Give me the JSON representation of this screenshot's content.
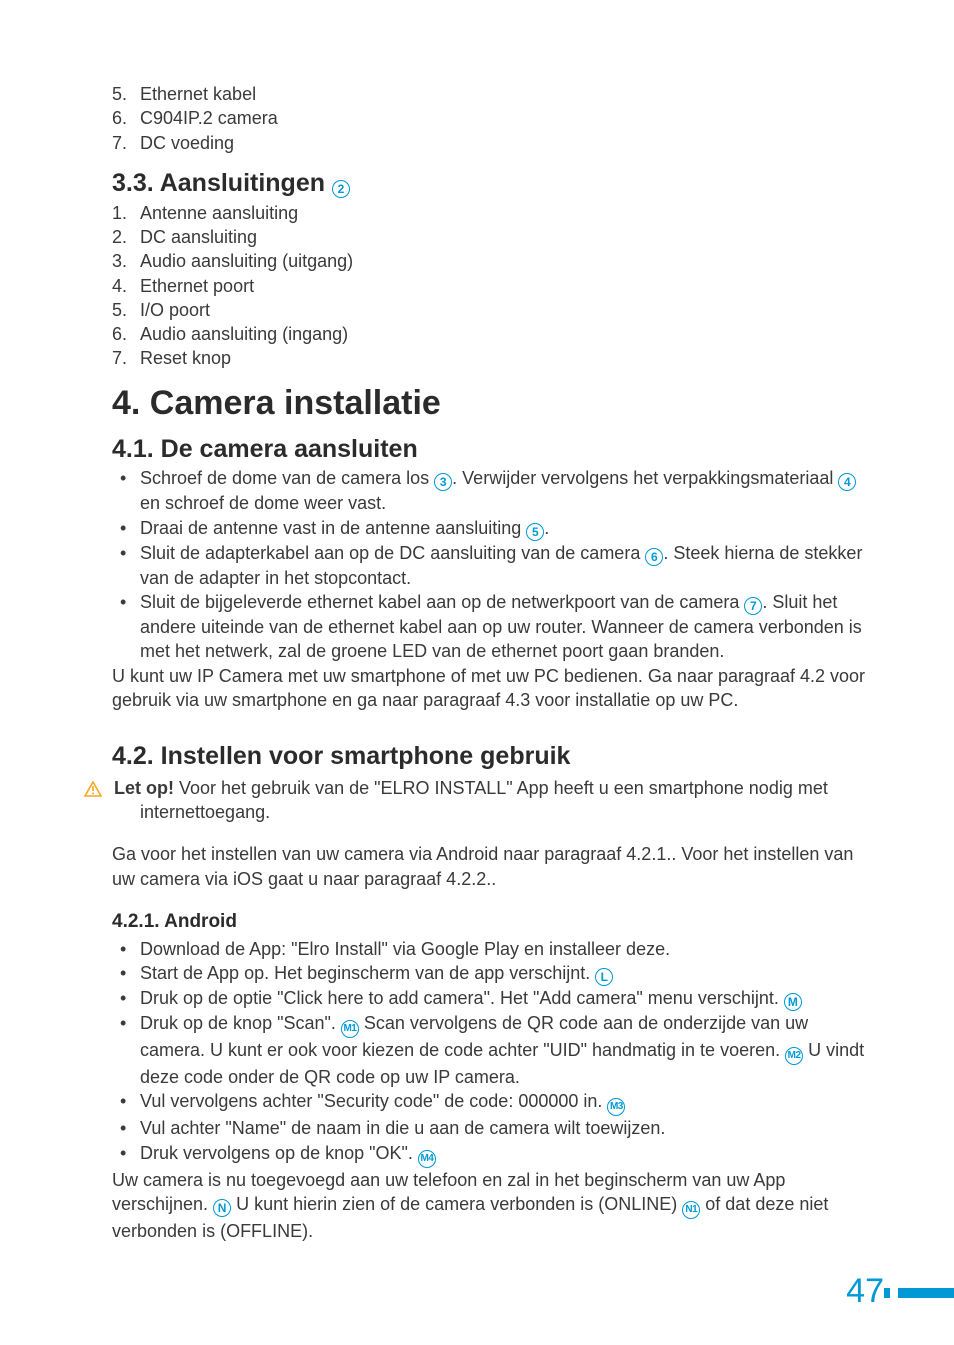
{
  "top_list": {
    "items": [
      {
        "n": "5.",
        "t": "Ethernet kabel"
      },
      {
        "n": "6.",
        "t": "C904IP.2 camera"
      },
      {
        "n": "7.",
        "t": "DC voeding"
      }
    ]
  },
  "s33": {
    "heading": "3.3.  Aansluitingen",
    "ref": "2",
    "items": [
      {
        "n": "1.",
        "t": "Antenne aansluiting"
      },
      {
        "n": "2.",
        "t": "DC aansluiting"
      },
      {
        "n": "3.",
        "t": "Audio aansluiting (uitgang)"
      },
      {
        "n": "4.",
        "t": "Ethernet poort"
      },
      {
        "n": "5.",
        "t": "I/O poort"
      },
      {
        "n": "6.",
        "t": "Audio aansluiting (ingang)"
      },
      {
        "n": "7.",
        "t": "Reset knop"
      }
    ]
  },
  "s4": {
    "heading": "4.    Camera installatie"
  },
  "s41": {
    "heading": "4.1.  De camera aansluiten",
    "b1a": "Schroef de dome van de camera los ",
    "r1": "3",
    "b1b": ". Verwijder vervolgens het verpakkingsmateriaal ",
    "r2": "4",
    "b1c": " en schroef de dome weer vast.",
    "b2a": "Draai de antenne vast in de antenne aansluiting ",
    "r3": "5",
    "b2b": ".",
    "b3a": "Sluit de adapterkabel aan op de DC aansluiting van de camera  ",
    "r4": "6",
    "b3b": ". Steek hierna de stekker van de adapter in het stopcontact.",
    "b4a": "Sluit de bijgeleverde ethernet kabel aan op de netwerkpoort van de camera ",
    "r5": "7",
    "b4b": ". Sluit het andere uiteinde van de ethernet kabel aan op uw router. Wanneer de camera verbonden is met het netwerk, zal de groene LED van de ethernet poort gaan branden.",
    "tail": "U kunt uw IP Camera met uw smartphone of met uw PC bedienen. Ga naar paragraaf 4.2 voor gebruik via uw smartphone en ga naar paragraaf 4.3 voor installatie op uw PC."
  },
  "s42": {
    "heading": "4.2.  Instellen voor smartphone gebruik",
    "attn_label": "Let op!",
    "attn_text": " Voor het gebruik van de \"ELRO INSTALL\" App heeft u een smartphone nodig met internettoegang.",
    "para": "Ga voor het instellen van uw camera via Android naar paragraaf 4.2.1.. Voor het instellen van uw camera via iOS gaat u naar paragraaf 4.2.2.."
  },
  "s421": {
    "heading": "4.2.1.  Android",
    "b1": "Download de App: \"Elro Install\" via Google Play en installeer deze.",
    "b2a": "Start de App op. Het beginscherm van de app verschijnt. ",
    "r2": "L",
    "b3a": "Druk op de optie \"Click here to add camera\". Het \"Add camera\" menu verschijnt. ",
    "r3": "M",
    "b4a": "Druk op de knop \"Scan\". ",
    "r4a": "M1",
    "b4b": " Scan vervolgens de QR code aan de onderzijde van uw camera. U kunt er ook voor kiezen de code achter \"UID\" handmatig in te voeren. ",
    "r4b": "M2",
    "b4c": " U vindt deze code onder de QR code op uw IP camera.",
    "b5a": "Vul vervolgens achter \"Security code\" de code: 000000 in. ",
    "r5": "M3",
    "b6": "Vul achter \"Name\" de naam in die u aan de camera wilt toewijzen.",
    "b7a": "Druk vervolgens op de knop \"OK\". ",
    "r7": "M4",
    "tail_a": "Uw camera is nu toegevoegd aan uw telefoon en zal in het beginscherm van uw App verschijnen. ",
    "rta": "N",
    "tail_b": " U kunt hierin zien of de camera verbonden is (ONLINE) ",
    "rtb": "N1",
    "tail_c": " of dat deze niet verbonden is (OFFLINE)."
  },
  "page": "47"
}
